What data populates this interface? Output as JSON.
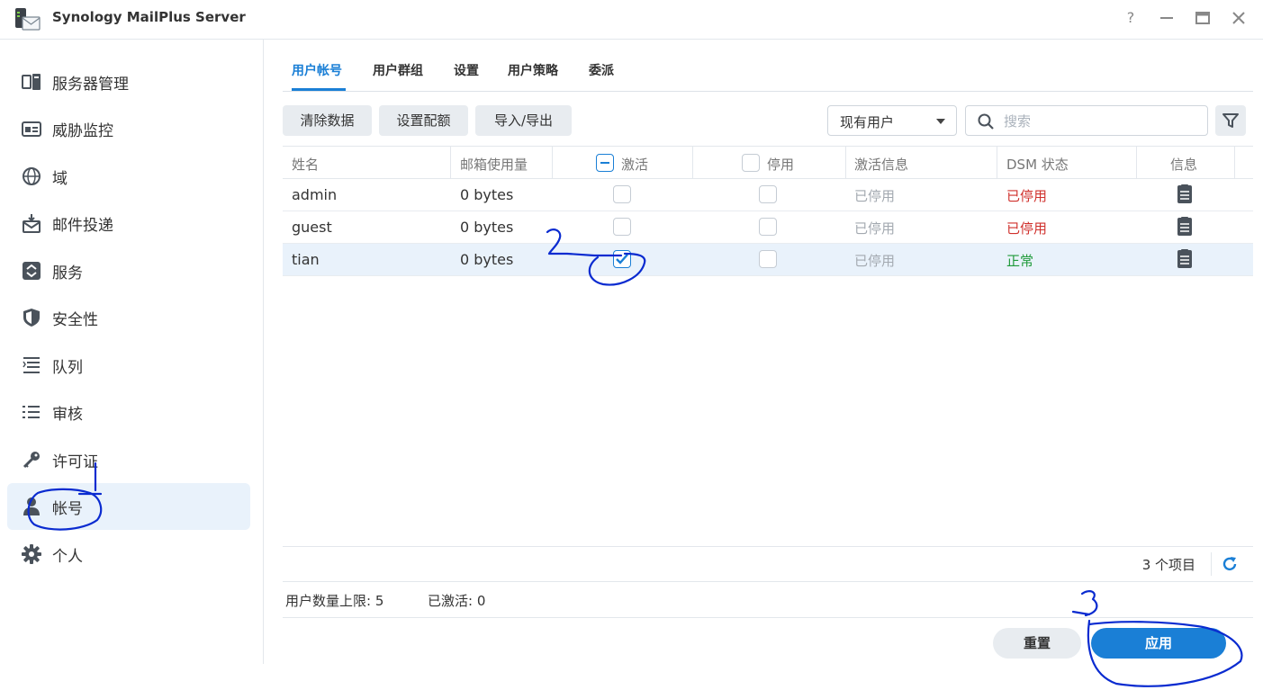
{
  "window": {
    "title": "Synology MailPlus Server"
  },
  "sidebar": {
    "items": [
      {
        "label": "服务器管理",
        "icon": "server-icon"
      },
      {
        "label": "威胁监控",
        "icon": "monitor-card-icon"
      },
      {
        "label": "域",
        "icon": "globe-icon"
      },
      {
        "label": "邮件投递",
        "icon": "mail-delivery-icon"
      },
      {
        "label": "服务",
        "icon": "service-icon"
      },
      {
        "label": "安全性",
        "icon": "shield-icon"
      },
      {
        "label": "队列",
        "icon": "queue-icon"
      },
      {
        "label": "审核",
        "icon": "list-icon"
      },
      {
        "label": "许可证",
        "icon": "key-icon"
      },
      {
        "label": "帐号",
        "icon": "user-icon"
      },
      {
        "label": "个人",
        "icon": "gear-icon"
      }
    ],
    "active": "帐号"
  },
  "tabs": [
    "用户帐号",
    "用户群组",
    "设置",
    "用户策略",
    "委派"
  ],
  "toolbar": {
    "clear_label": "清除数据",
    "quota_label": "设置配额",
    "import_label": "导入/导出",
    "filter_select": "现有用户",
    "search_placeholder": "搜索"
  },
  "table": {
    "columns": [
      "姓名",
      "邮箱使用量",
      "激活",
      "停用",
      "激活信息",
      "DSM 状态",
      "信息"
    ],
    "rows": [
      {
        "name": "admin",
        "usage": "0 bytes",
        "activated": false,
        "disabled": false,
        "activation_info": "已停用",
        "dsm_status": "已停用"
      },
      {
        "name": "guest",
        "usage": "0 bytes",
        "activated": false,
        "disabled": false,
        "activation_info": "已停用",
        "dsm_status": "已停用"
      },
      {
        "name": "tian",
        "usage": "0 bytes",
        "activated": true,
        "disabled": false,
        "activation_info": "已停用",
        "dsm_status": "正常"
      }
    ],
    "item_count": "3 个项目"
  },
  "stats": {
    "user_limit": "用户数量上限: 5",
    "activated": "已激活: 0"
  },
  "buttons": {
    "reset": "重置",
    "apply": "应用"
  },
  "annotations": {
    "one": "1",
    "two": "2",
    "three": "3"
  },
  "colors": {
    "accent": "#1a7fd6",
    "selected_row": "#e9f2fb",
    "status_red": "#d0312d",
    "status_green": "#1f9a3a",
    "annotation_ink": "#0a2bd0"
  }
}
